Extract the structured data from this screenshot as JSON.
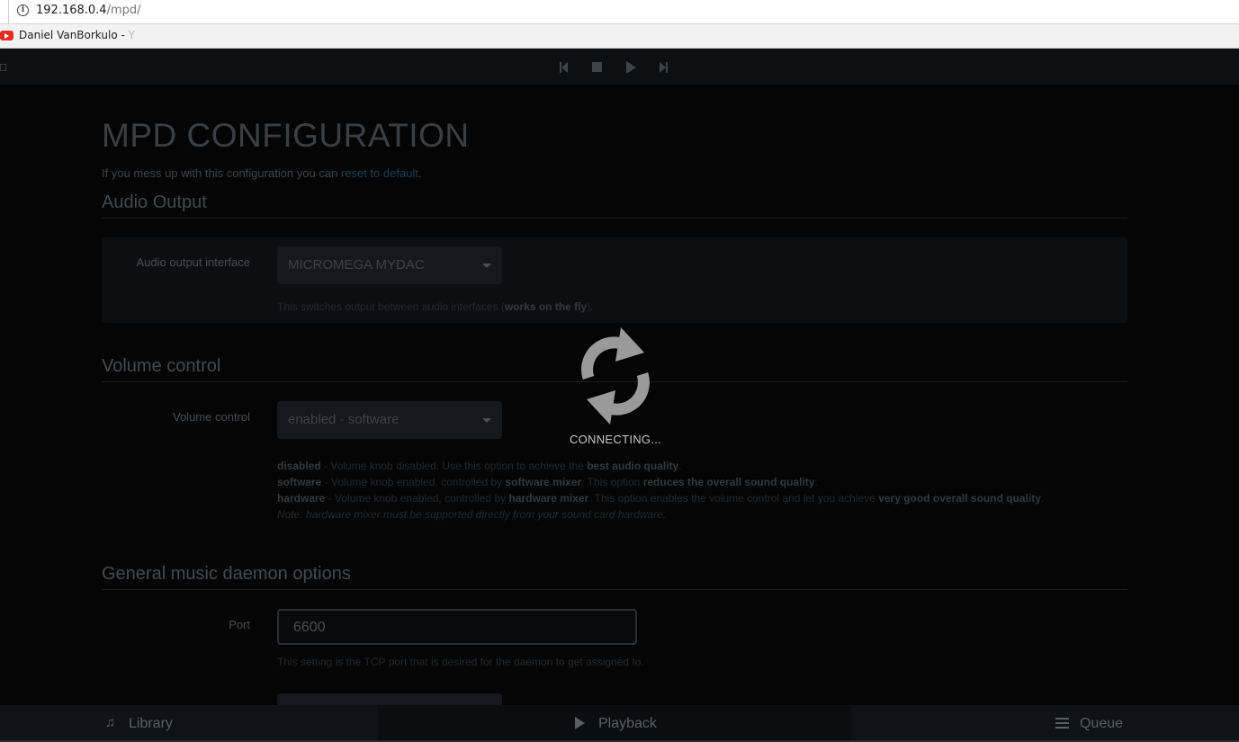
{
  "browser": {
    "url_host": "192.168.0.4",
    "url_path": "/mpd/",
    "bookmark_label": "Daniel VanBorkulo - ",
    "bookmark_fade": "Y"
  },
  "player_controls": {
    "prev": "previous-icon",
    "stop": "stop-icon",
    "play": "play-icon",
    "next": "next-icon"
  },
  "page": {
    "title": "MPD CONFIGURATION",
    "intro_text": "If you mess up with this configuration you can ",
    "intro_link": "reset to default",
    "intro_end": "."
  },
  "audio_output": {
    "section_title": "Audio Output",
    "label": "Audio output interface",
    "selected": "MICROMEGA MYDAC",
    "help_prefix": "This switches output between audio interfaces (",
    "help_bold": "works on the fly",
    "help_suffix": ")."
  },
  "volume": {
    "section_title": "Volume control",
    "label": "Volume control",
    "selected": "enabled - software",
    "help": {
      "disabled_key": "disabled",
      "disabled_text": " - Volume knob disabled. Use this option to achieve the ",
      "disabled_bold": "best audio quality",
      "disabled_end": ".",
      "software_key": "software",
      "software_text": " - Volume knob enabled, controlled by ",
      "software_bold1": "software mixer",
      "software_mid": ". This option ",
      "software_bold2": "reduces the overall sound quality",
      "software_end": ".",
      "hardware_key": "hardware",
      "hardware_text": " - Volume knob enabled, controlled by ",
      "hardware_bold1": "hardware mixer",
      "hardware_mid": ". This option enables the volume control and let you achieve ",
      "hardware_bold2": "very good overall sound quality",
      "hardware_end": ".",
      "note": "Note: hardware mixer must be supported directly from your sound card hardware."
    }
  },
  "general": {
    "section_title": "General music daemon options",
    "port_label": "Port",
    "port_value": "6600",
    "port_help": "This setting is the TCP port that is desired for the daemon to get assigned to."
  },
  "overlay": {
    "status": "CONNECTING..."
  },
  "bottom_nav": {
    "library": "Library",
    "playback": "Playback",
    "queue": "Queue"
  }
}
